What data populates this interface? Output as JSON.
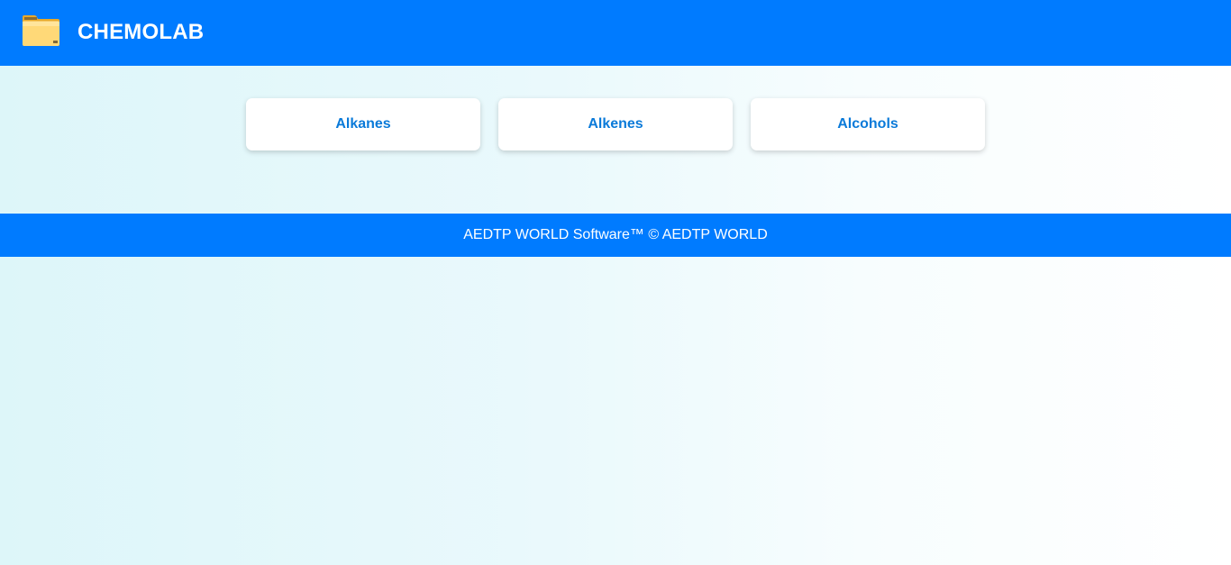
{
  "header": {
    "logo_icon": "folder-icon",
    "title": "CHEMOLAB"
  },
  "topics": [
    {
      "label": "Alkanes"
    },
    {
      "label": "Alkenes"
    },
    {
      "label": "Alcohols"
    }
  ],
  "footer": {
    "text": "AEDTP WORLD Software™ © AEDTP WORLD"
  },
  "colors": {
    "accent": "#007bff",
    "card_text": "#0a7ad9",
    "background_start": "#ddf6f9",
    "background_end": "#ffffff"
  }
}
